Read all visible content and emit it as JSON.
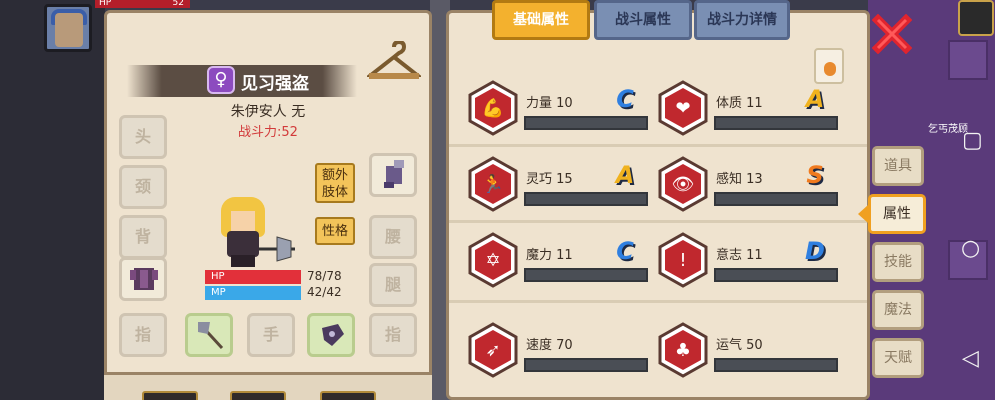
{
  "hud": {
    "hp_label": "HP",
    "hp_value": "52"
  },
  "character": {
    "class_name": "见习强盗",
    "gender_symbol": "♀",
    "title": "朱伊安人 无",
    "power": "战斗力:52",
    "buttons": {
      "extra_limb": "额外\n肢体",
      "personality": "性格"
    },
    "stats": {
      "hp_label": "HP",
      "hp_value": "78/78",
      "mp_label": "MP",
      "mp_value": "42/42"
    },
    "slots": {
      "head": "头",
      "neck": "颈",
      "back": "背",
      "waist": "腰",
      "legs": "腿",
      "finger_left": "指",
      "hand": "手",
      "finger_right": "指"
    }
  },
  "tabs": {
    "basic": "基础属性",
    "combat": "战斗属性",
    "combat_detail": "战斗力详情"
  },
  "attributes": [
    {
      "label": "力量 10",
      "grade": "C",
      "grade_color": "#2f7fe0",
      "icon": "strength-icon"
    },
    {
      "label": "体质 11",
      "grade": "A",
      "grade_color": "#f0b21e",
      "icon": "constitution-icon"
    },
    {
      "label": "灵巧 15",
      "grade": "A",
      "grade_color": "#f0b21e",
      "icon": "dexterity-icon"
    },
    {
      "label": "感知 13",
      "grade": "S",
      "grade_color": "#f07a1e",
      "icon": "perception-icon"
    },
    {
      "label": "魔力 11",
      "grade": "C",
      "grade_color": "#2f7fe0",
      "icon": "magic-icon"
    },
    {
      "label": "意志 11",
      "grade": "D",
      "grade_color": "#2f7fe0",
      "icon": "will-icon"
    },
    {
      "label": "速度 70",
      "icon": "speed-icon"
    },
    {
      "label": "运气 50",
      "icon": "luck-icon"
    }
  ],
  "side_menu": {
    "items": "道具",
    "attributes": "属性",
    "skills": "技能",
    "magic": "魔法",
    "talent": "天赋"
  },
  "world": {
    "npc_label": "乞丐茂顾"
  },
  "colors": {
    "accent": "#f3b12e",
    "attr_red": "#c0282e",
    "panel": "#efe3cf"
  }
}
